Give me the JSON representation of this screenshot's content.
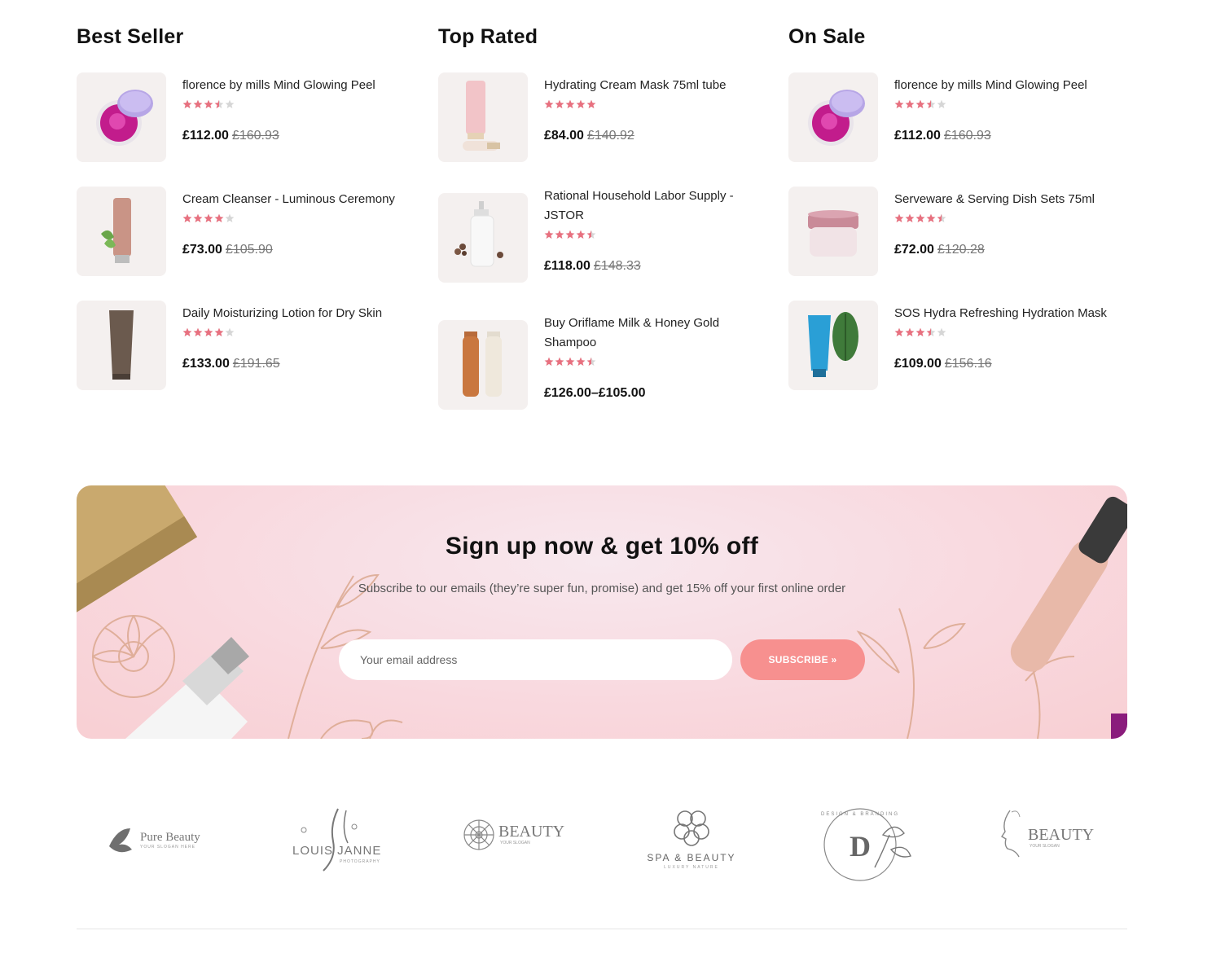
{
  "columns": [
    {
      "title": "Best Seller",
      "products": [
        {
          "name": "florence by mills Mind Glowing Peel",
          "rating": 3.5,
          "price": "£112.00",
          "old_price": "£160.93",
          "image": "purple-jar-image"
        },
        {
          "name": "Cream Cleanser - Luminous Ceremony",
          "rating": 4,
          "price": "£73.00",
          "old_price": "£105.90",
          "image": "pink-tube-image"
        },
        {
          "name": "Daily Moisturizing Lotion for Dry Skin",
          "rating": 4,
          "price": "£133.00",
          "old_price": "£191.65",
          "image": "brown-tube-image"
        }
      ]
    },
    {
      "title": "Top Rated",
      "products": [
        {
          "name": "Hydrating Cream Mask 75ml tube",
          "rating": 5,
          "price": "£84.00",
          "old_price": "£140.92",
          "image": "pink-tubes-image"
        },
        {
          "name": "Rational Household Labor Supply - JSTOR",
          "rating": 4.5,
          "price": "£118.00",
          "old_price": "£148.33",
          "image": "pump-bottle-image"
        },
        {
          "name": "Buy Oriflame Milk & Honey Gold Shampoo",
          "rating": 4.5,
          "price": "£126.00–£105.00",
          "old_price": "",
          "image": "shampoo-bottles-image"
        }
      ]
    },
    {
      "title": "On Sale",
      "products": [
        {
          "name": "florence by mills Mind Glowing Peel",
          "rating": 3.5,
          "price": "£112.00",
          "old_price": "£160.93",
          "image": "purple-jar-image"
        },
        {
          "name": "Serveware & Serving Dish Sets 75ml",
          "rating": 4.5,
          "price": "£72.00",
          "old_price": "£120.28",
          "image": "cream-jar-image"
        },
        {
          "name": "SOS Hydra Refreshing Hydration Mask",
          "rating": 3.5,
          "price": "£109.00",
          "old_price": "£156.16",
          "image": "blue-tube-image"
        }
      ]
    }
  ],
  "newsletter": {
    "title": "Sign up now & get 10% off",
    "subtitle": "Subscribe to our emails (they’re super fun, promise) and get 15% off your first online order",
    "email_placeholder": "Your email address",
    "button_label": "SUBSCRIBE »"
  },
  "brand_logos": [
    {
      "name": "Pure Beauty",
      "tagline": "YOUR SLOGAN HERE"
    },
    {
      "name": "LOUIS JANNE",
      "tagline": "PHOTOGRAPHY"
    },
    {
      "name": "BEAUTY",
      "tagline": "YOUR SLOGAN"
    },
    {
      "name": "SPA & BEAUTY",
      "tagline": "LUXURY NATURE"
    },
    {
      "name": "D",
      "tagline": "DESIGN & BRANDING"
    },
    {
      "name": "BEAUTY",
      "tagline": "YOUR SLOGAN"
    }
  ],
  "colors": {
    "star": "#e8707f",
    "star_empty": "#d6d6d6",
    "button": "#f7908f"
  }
}
